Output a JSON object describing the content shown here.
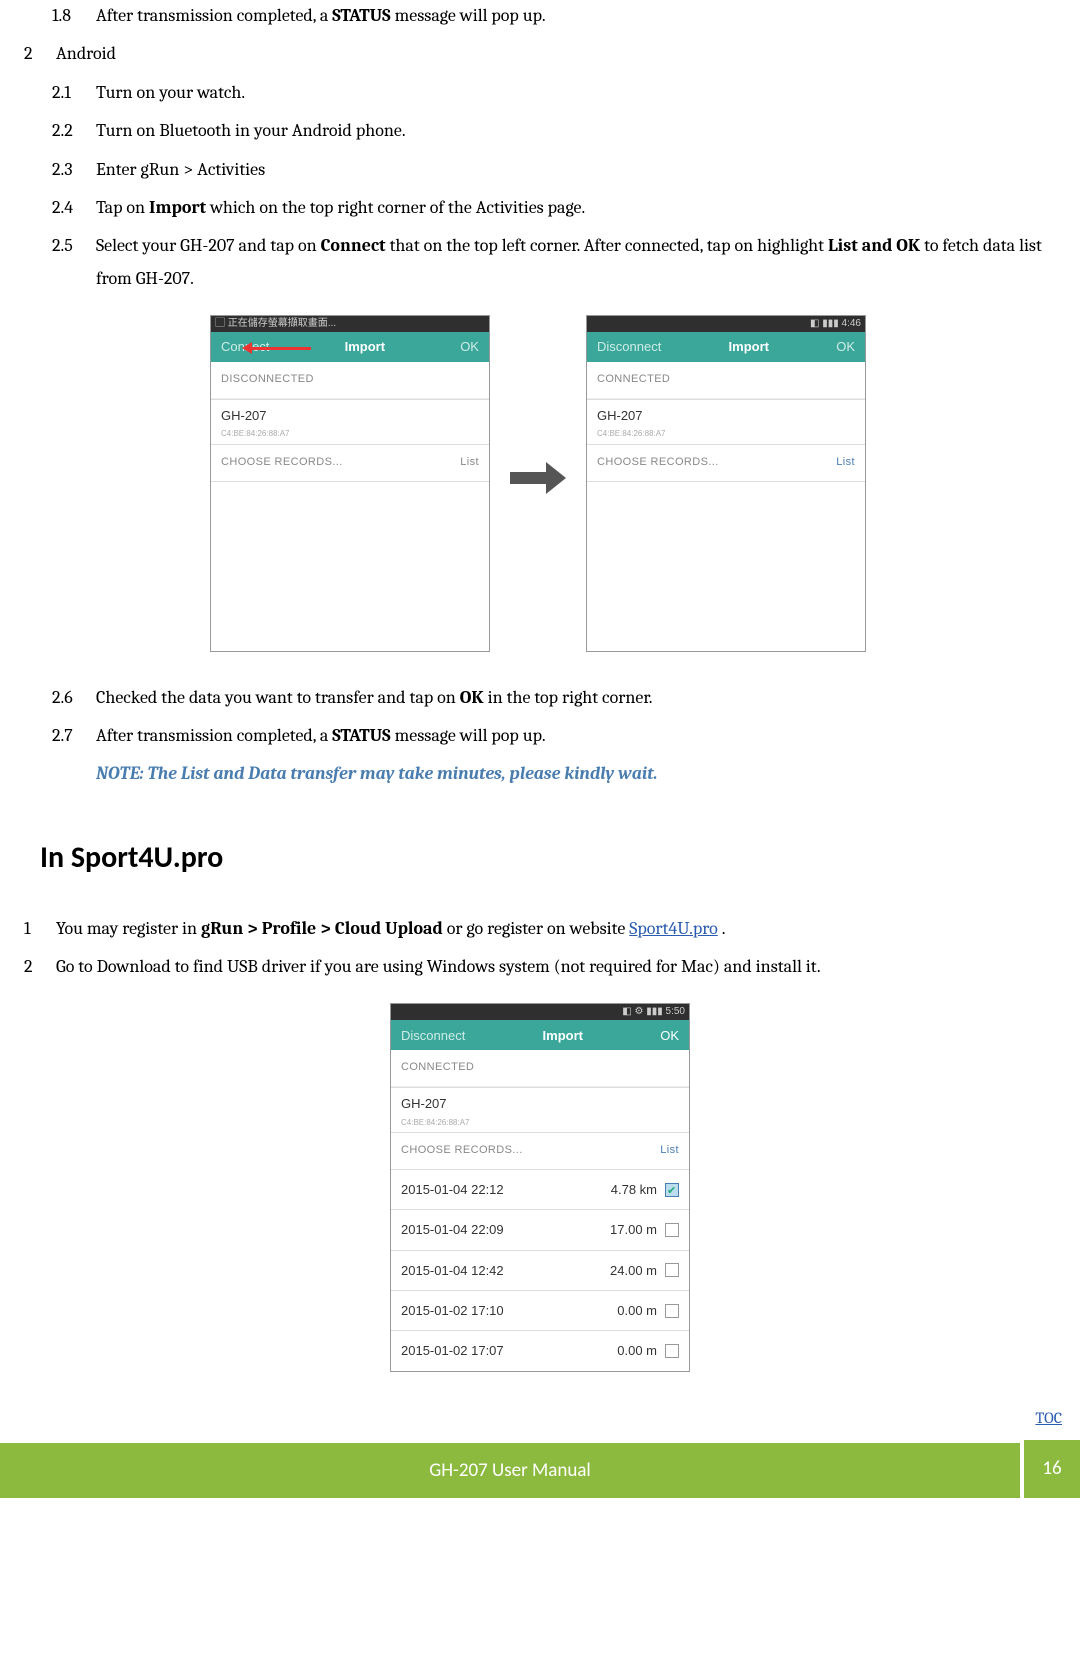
{
  "items": {
    "i18": {
      "num": "1.8",
      "pre": "After transmission completed, a ",
      "bold": "STATUS",
      "post": " message will pop up."
    },
    "android": {
      "num": "2",
      "txt": "Android"
    },
    "i21": {
      "num": "2.1",
      "txt": "Turn on your watch."
    },
    "i22": {
      "num": "2.2",
      "txt": "Turn on Bluetooth in your Android phone."
    },
    "i23": {
      "num": "2.3",
      "txt": "Enter gRun > Activities"
    },
    "i24": {
      "num": "2.4",
      "pre": "Tap on ",
      "bold": "Import",
      "post": " which on the top right corner of the Activities page."
    },
    "i25": {
      "num": "2.5",
      "pre": "Select your GH-207 and tap on ",
      "bold1": "Connect",
      "mid": " that on the top left corner. After connected, tap on highlight ",
      "bold2": "List and OK",
      "post": " to fetch data list from GH-207."
    },
    "i26": {
      "num": "2.6",
      "pre": "Checked the data you want to transfer and tap on ",
      "bold": "OK",
      "post": " in the top right corner."
    },
    "i27": {
      "num": "2.7",
      "pre": "After transmission completed, a ",
      "bold": "STATUS",
      "post": " message will pop up."
    }
  },
  "note": "NOTE: The List and Data transfer may take minutes, please kindly wait.",
  "heading": "In Sport4U.pro",
  "sp1": {
    "num": "1",
    "pre": "You may register in ",
    "bold": "gRun > Profile > Cloud Upload",
    "mid": " or go register on website ",
    "link": "Sport4U.pro",
    "post": " ."
  },
  "sp2": {
    "num": "2",
    "txt": "Go to Download to find USB driver if you are using Windows system (not required for Mac) and install it."
  },
  "fig1": {
    "left": {
      "status_l": "正在儲存螢幕擷取畫面...",
      "connect": "Connect",
      "import": "Import",
      "ok": "OK",
      "state": "DISCONNECTED",
      "dev": "GH-207",
      "mac": "C4:BE:84:26:88:A7",
      "choose": "CHOOSE RECORDS...",
      "list": "List"
    },
    "right": {
      "time": "4:46",
      "connect": "Disconnect",
      "import": "Import",
      "ok": "OK",
      "state": "CONNECTED",
      "dev": "GH-207",
      "mac": "C4:BE:84:26:88:A7",
      "choose": "CHOOSE RECORDS...",
      "list": "List"
    }
  },
  "fig2": {
    "time": "5:50",
    "connect": "Disconnect",
    "import": "Import",
    "ok": "OK",
    "state": "CONNECTED",
    "dev": "GH-207",
    "mac": "C4:BE:84:26:88:A7",
    "choose": "CHOOSE RECORDS...",
    "list": "List",
    "rows": [
      {
        "dt": "2015-01-04 22:12",
        "dist": "4.78 km",
        "on": true
      },
      {
        "dt": "2015-01-04 22:09",
        "dist": "17.00 m",
        "on": false
      },
      {
        "dt": "2015-01-04 12:42",
        "dist": "24.00 m",
        "on": false
      },
      {
        "dt": "2015-01-02 17:10",
        "dist": "0.00 m",
        "on": false
      },
      {
        "dt": "2015-01-02 17:07",
        "dist": "0.00 m",
        "on": false
      }
    ]
  },
  "toc": "TOC",
  "footer_title": "GH-207 User Manual",
  "page_num": "16"
}
